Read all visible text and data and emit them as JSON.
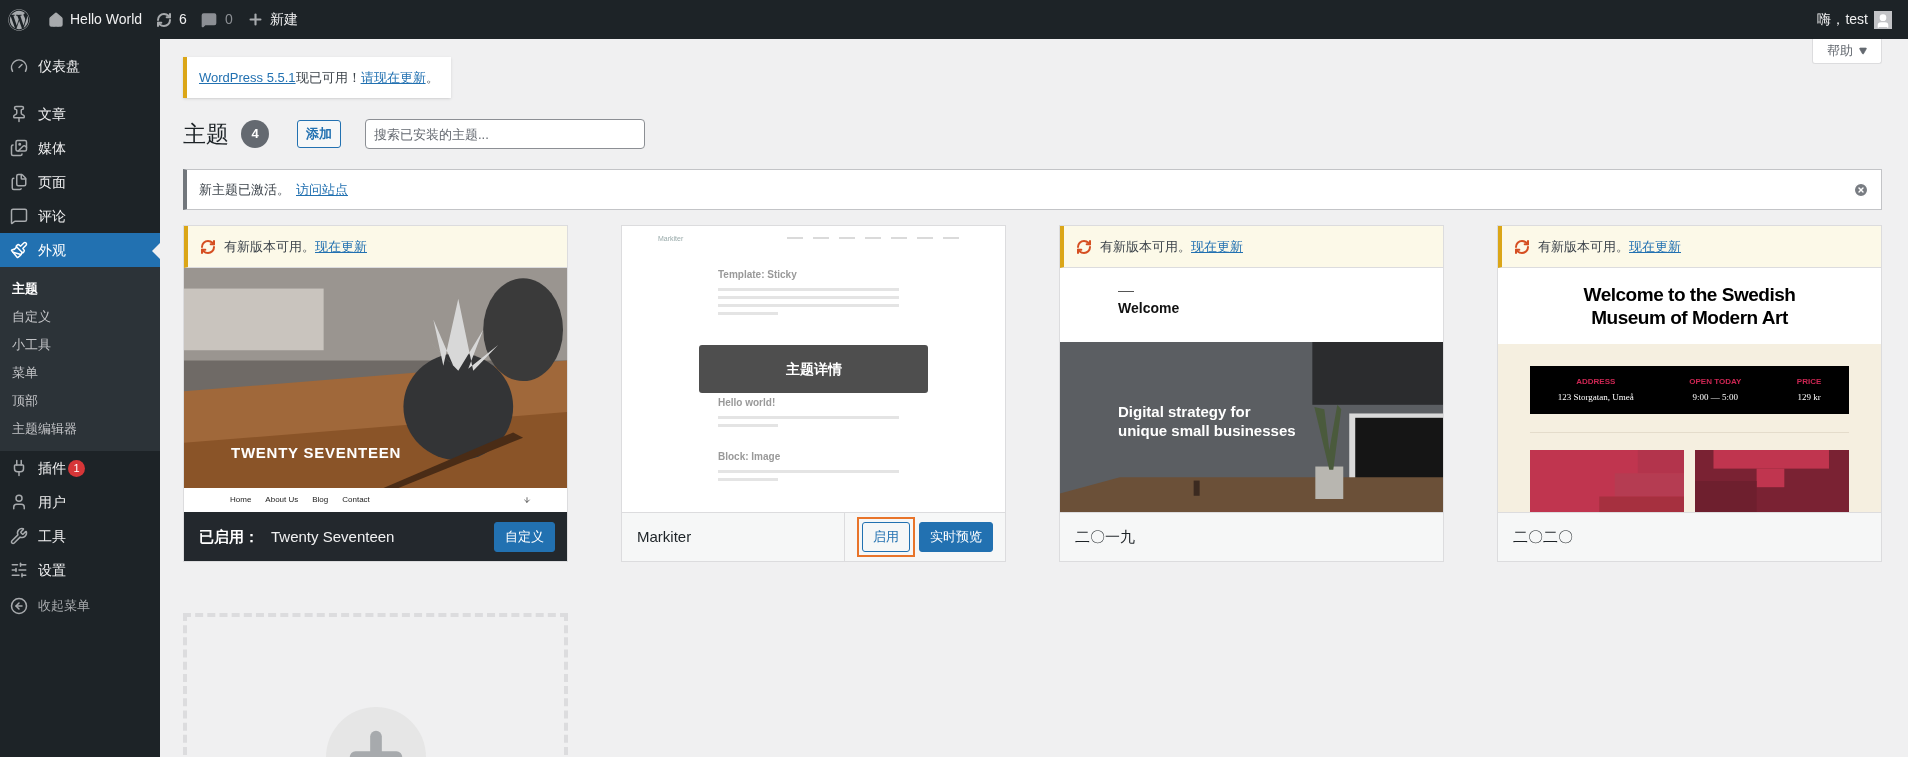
{
  "admin_bar": {
    "site": "Hello World",
    "updates": "6",
    "comments": "0",
    "new": "新建",
    "greeting": "嗨，test"
  },
  "help_button": "帮助",
  "sidebar": {
    "items": [
      {
        "label": "仪表盘",
        "selected": false
      },
      {
        "label": "文章",
        "selected": false
      },
      {
        "label": "媒体",
        "selected": false
      },
      {
        "label": "页面",
        "selected": false
      },
      {
        "label": "评论",
        "selected": false
      },
      {
        "label": "外观",
        "selected": true,
        "children": [
          {
            "label": "主题",
            "selected": true
          },
          {
            "label": "自定义",
            "selected": false
          },
          {
            "label": "小工具",
            "selected": false
          },
          {
            "label": "菜单",
            "selected": false
          },
          {
            "label": "顶部",
            "selected": false
          },
          {
            "label": "主题编辑器",
            "selected": false
          }
        ]
      },
      {
        "label": "插件",
        "selected": false,
        "badge": "1"
      },
      {
        "label": "用户",
        "selected": false
      },
      {
        "label": "工具",
        "selected": false
      },
      {
        "label": "设置",
        "selected": false
      }
    ],
    "collapse": "收起菜单"
  },
  "update_notice": {
    "link": "WordPress 5.5.1",
    "text": "现已可用！",
    "action": "请现在更新",
    "end": "。"
  },
  "heading": {
    "title": "主题",
    "count": "4",
    "add": "添加",
    "search_placeholder": "搜索已安装的主题..."
  },
  "activated_notice": {
    "text": "新主题已激活。",
    "link": "访问站点"
  },
  "themes": [
    {
      "kind": "twentyseventeen",
      "update": {
        "text": "有新版本可用。",
        "link": "现在更新"
      },
      "active": true,
      "active_label": "已启用：",
      "name": "Twenty Seventeen",
      "preview": {
        "title": "TWENTY SEVENTEEN",
        "nav": [
          "Home",
          "About Us",
          "Blog",
          "Contact"
        ]
      },
      "buttons": [
        {
          "label": "自定义",
          "kind": "primary",
          "highlighted": false
        }
      ]
    },
    {
      "kind": "markiter",
      "active": false,
      "name": "Markiter",
      "details_overlay": "主题详情",
      "preview": {
        "site": "Markiter",
        "posts": [
          "Template: Sticky",
          "Hello world!",
          "Block: Image"
        ]
      },
      "buttons": [
        {
          "label": "启用",
          "kind": "secondary",
          "highlighted": true
        },
        {
          "label": "实时预览",
          "kind": "primary",
          "highlighted": false
        }
      ]
    },
    {
      "kind": "twentynineteen",
      "update": {
        "text": "有新版本可用。",
        "link": "现在更新"
      },
      "active": false,
      "name": "二〇一九",
      "preview": {
        "welcome": "Welcome",
        "headline": "Digital strategy for unique small businesses"
      }
    },
    {
      "kind": "twentytwenty",
      "update": {
        "text": "有新版本可用。",
        "link": "现在更新"
      },
      "active": false,
      "name": "二〇二〇",
      "preview": {
        "title": "Welcome to the Swedish Museum of Modern Art",
        "info": [
          {
            "label": "ADDRESS",
            "value": "123 Storgatan, Umeå"
          },
          {
            "label": "OPEN TODAY",
            "value": "9:00 — 5:00"
          },
          {
            "label": "PRICE",
            "value": "129 kr"
          }
        ]
      }
    }
  ]
}
